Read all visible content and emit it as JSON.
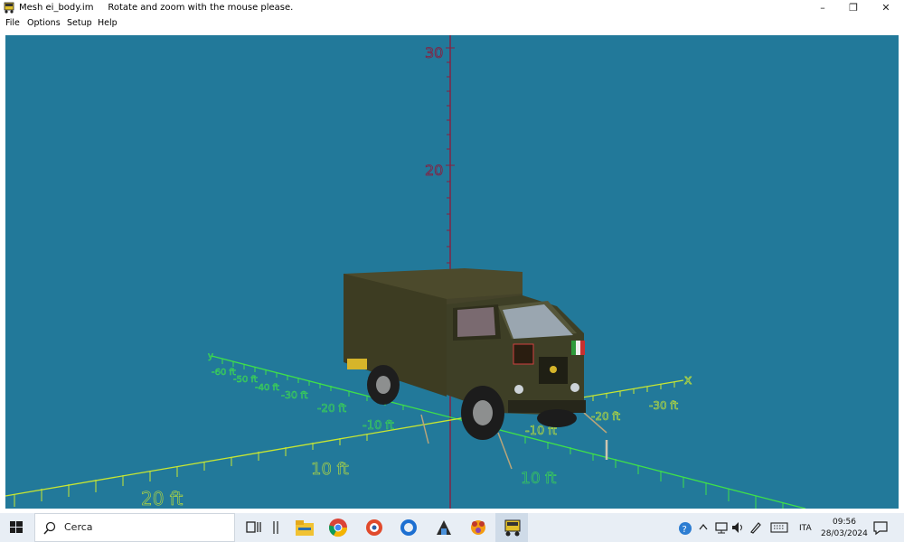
{
  "window": {
    "title": "Mesh ei_body.im",
    "hint": "Rotate and zoom with the mouse please.",
    "controls": {
      "minimize": "–",
      "restore": "❐",
      "close": "✕"
    }
  },
  "menu": [
    "File",
    "Options",
    "Setup",
    "Help"
  ],
  "viewport": {
    "z_ticks": [
      "30",
      "20"
    ],
    "x_axis_label": "x",
    "y_axis_label": "y",
    "x_ticks": [
      "-10 ft",
      "-20 ft",
      "-30 ft"
    ],
    "y_ticks": [
      "-60 ft",
      "-50 ft",
      "-40 ft",
      "-30 ft",
      "-20 ft",
      "-10 ft"
    ],
    "front_ticks": [
      "10 ft",
      "20 ft",
      "10 ft"
    ],
    "colors": {
      "background": "#22799a",
      "axis_z": "#8a1e3e",
      "axis_x": "#c8e632",
      "axis_y": "#3fe04a"
    }
  },
  "taskbar": {
    "search_placeholder": "Cerca",
    "apps": [
      "task-view-icon",
      "file-explorer-icon",
      "chrome-icon",
      "app-icon-red",
      "app-icon-blue",
      "app-icon-dark",
      "app-icon-orange",
      "mesh-viewer-icon"
    ],
    "tray": {
      "language": "ITA",
      "time": "09:56",
      "date": "28/03/2024"
    }
  }
}
